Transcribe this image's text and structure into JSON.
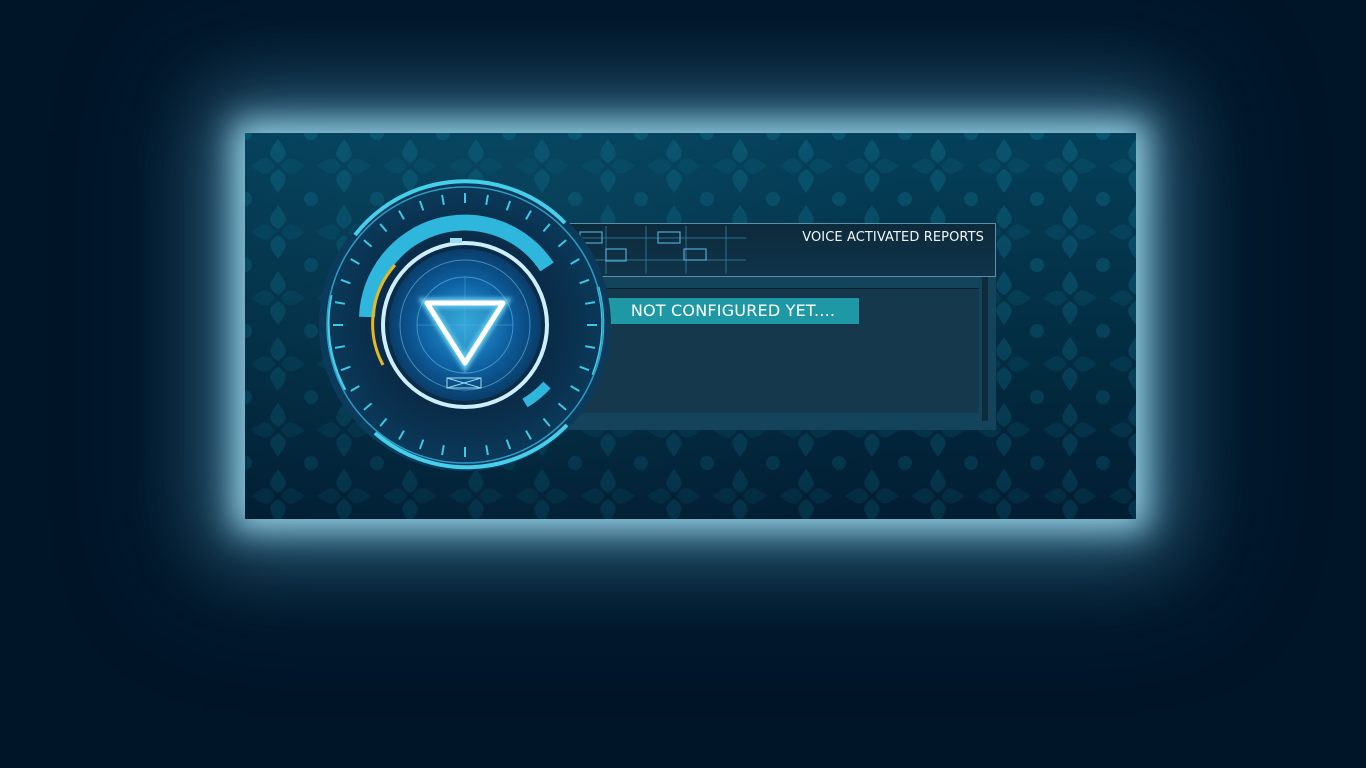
{
  "panel": {
    "title": "VOICE ACTIVATED REPORTS",
    "status": "NOT CONFIGURED YET...."
  },
  "icons": {
    "reactor": "arc-reactor-icon",
    "center": "inverted-triangle-icon"
  },
  "colors": {
    "page_background": "#011528",
    "glow": "#a0dcf0",
    "accent_cyan": "#3cc8e6",
    "status_bg": "#1f98a6",
    "warning_arc": "#e8b820",
    "panel_header": "#10344a"
  }
}
